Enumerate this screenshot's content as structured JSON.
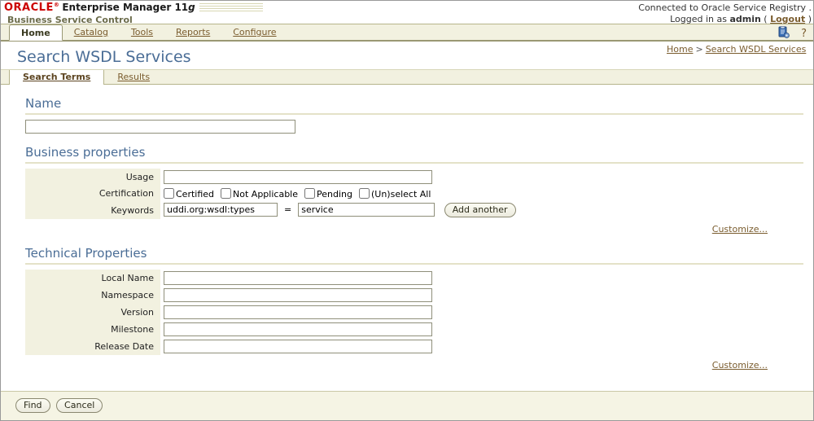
{
  "header": {
    "logo": "ORACLE",
    "logo_reg": "®",
    "product": "Enterprise Manager 11",
    "product_g": "g",
    "subtitle": "Business Service Control",
    "connected_text": "Connected to Oracle Service Registry .",
    "logged_in_prefix": "Logged in as ",
    "user": "admin",
    "paren_open": " ( ",
    "logout_label": "Logout",
    "paren_close": " )"
  },
  "global_tabs": [
    {
      "label": "Home",
      "active": true
    },
    {
      "label": "Catalog",
      "active": false
    },
    {
      "label": "Tools",
      "active": false
    },
    {
      "label": "Reports",
      "active": false
    },
    {
      "label": "Configure",
      "active": false
    }
  ],
  "global_tools": {
    "preferences_icon": "clipboard-preferences-icon",
    "help_label": "?"
  },
  "page": {
    "title": "Search WSDL Services",
    "breadcrumb": {
      "home": "Home",
      "separator": ">",
      "current": "Search WSDL Services"
    }
  },
  "sub_tabs": [
    {
      "label": "Search Terms",
      "active": true
    },
    {
      "label": "Results",
      "active": false
    }
  ],
  "sections": {
    "name": {
      "heading": "Name",
      "input_value": "",
      "input_placeholder": ""
    },
    "business": {
      "heading": "Business properties",
      "usage_label": "Usage",
      "usage_value": "",
      "certification_label": "Certification",
      "certification_options": [
        {
          "label": "Certified",
          "checked": false
        },
        {
          "label": "Not Applicable",
          "checked": false
        },
        {
          "label": "Pending",
          "checked": false
        },
        {
          "label": "(Un)select All",
          "checked": false
        }
      ],
      "keywords_label": "Keywords",
      "keyword_name": "uddi.org:wsdl:types",
      "keyword_equals": "=",
      "keyword_value": "service",
      "add_another_label": "Add another",
      "customize_label": "Customize..."
    },
    "technical": {
      "heading": "Technical Properties",
      "fields": [
        {
          "label": "Local Name",
          "value": ""
        },
        {
          "label": "Namespace",
          "value": ""
        },
        {
          "label": "Version",
          "value": ""
        },
        {
          "label": "Milestone",
          "value": ""
        },
        {
          "label": "Release Date",
          "value": ""
        }
      ],
      "customize_label": "Customize..."
    }
  },
  "footer": {
    "find_label": "Find",
    "cancel_label": "Cancel"
  },
  "colors": {
    "oracle_red": "#cc0000",
    "heading_blue": "#4a6d96",
    "link_brown": "#7a5c2e",
    "panel_beige": "#f2f1e0",
    "footer_beige": "#f5f4e4"
  }
}
